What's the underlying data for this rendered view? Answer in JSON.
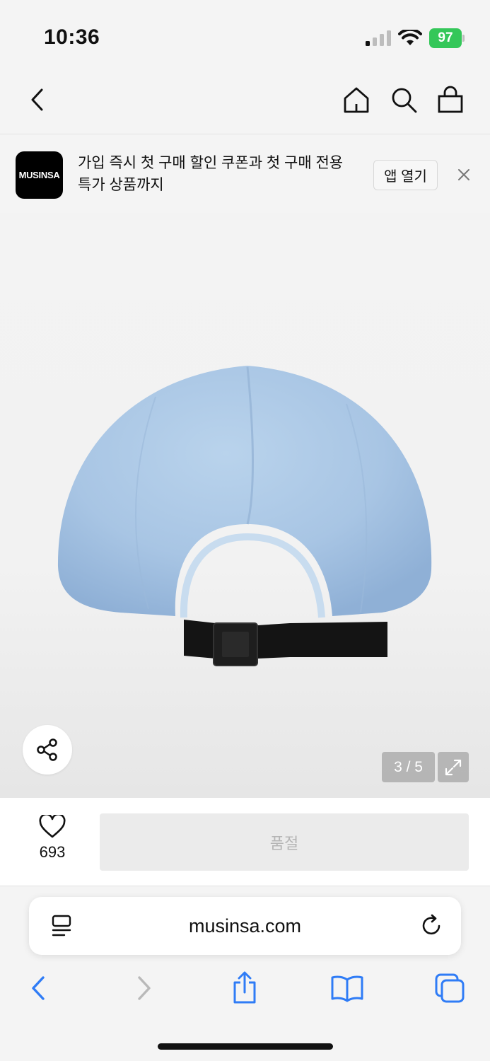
{
  "status_bar": {
    "time": "10:36",
    "battery": "97"
  },
  "nav": {
    "back_icon": "chevron-left-icon",
    "home_icon": "home-icon",
    "search_icon": "search-icon",
    "cart_icon": "shopping-bag-icon"
  },
  "banner": {
    "logo_text": "MUSINSA",
    "message": "가입 즉시 첫 구매 할인 쿠폰과 첫 구매 전용 특가 상품까지",
    "open_app_label": "앱 열기",
    "close_icon": "close-icon"
  },
  "product": {
    "image_desc_icon": "product-cap-image",
    "page_indicator": "3 / 5",
    "share_icon": "share-icon",
    "expand_icon": "expand-icon",
    "cap_color": "#a9c6e4",
    "strap_color": "#111111"
  },
  "purchase": {
    "like_count": "693",
    "soldout_label": "품절"
  },
  "safari": {
    "url": "musinsa.com",
    "accent_color": "#2f7cf6"
  }
}
